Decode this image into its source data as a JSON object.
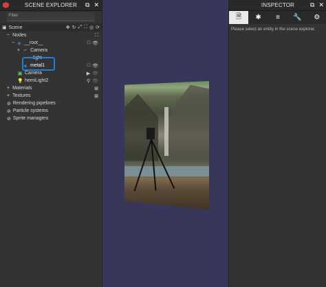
{
  "left_panel": {
    "title": "SCENE EXPLORER",
    "filter_placeholder": "Filter",
    "scene_label": "Scene",
    "tree": {
      "nodes_label": "Nodes",
      "root_label": "__root__",
      "camera_child_label": "Camera",
      "light_label": "light",
      "metal_label": "metal1",
      "camera_label": "Camera",
      "hemi_label": "hemiLight2"
    },
    "sections": {
      "materials": "Materials",
      "textures": "Textures",
      "rendering_pipelines": "Rendering pipelines",
      "particle_systems": "Particle systems",
      "sprite_managers": "Sprite managers"
    }
  },
  "right_panel": {
    "title": "INSPECTOR",
    "message": "Please select an entity in the scene explorer."
  },
  "colors": {
    "panel_bg": "#333333",
    "viewport_bg": "#36375a",
    "selection_outline": "#1f7fd6",
    "logo_red": "#d33f3f"
  },
  "icons": [
    "babylon-logo-icon",
    "detach-icon",
    "close-icon",
    "scene-icon",
    "move-icon",
    "refresh-icon",
    "fullscreen-icon",
    "gizmo-icon",
    "eye-icon",
    "camera-icon",
    "bulb-icon",
    "file-icon",
    "bug-icon",
    "stats-icon",
    "wrench-icon",
    "gear-icon"
  ]
}
